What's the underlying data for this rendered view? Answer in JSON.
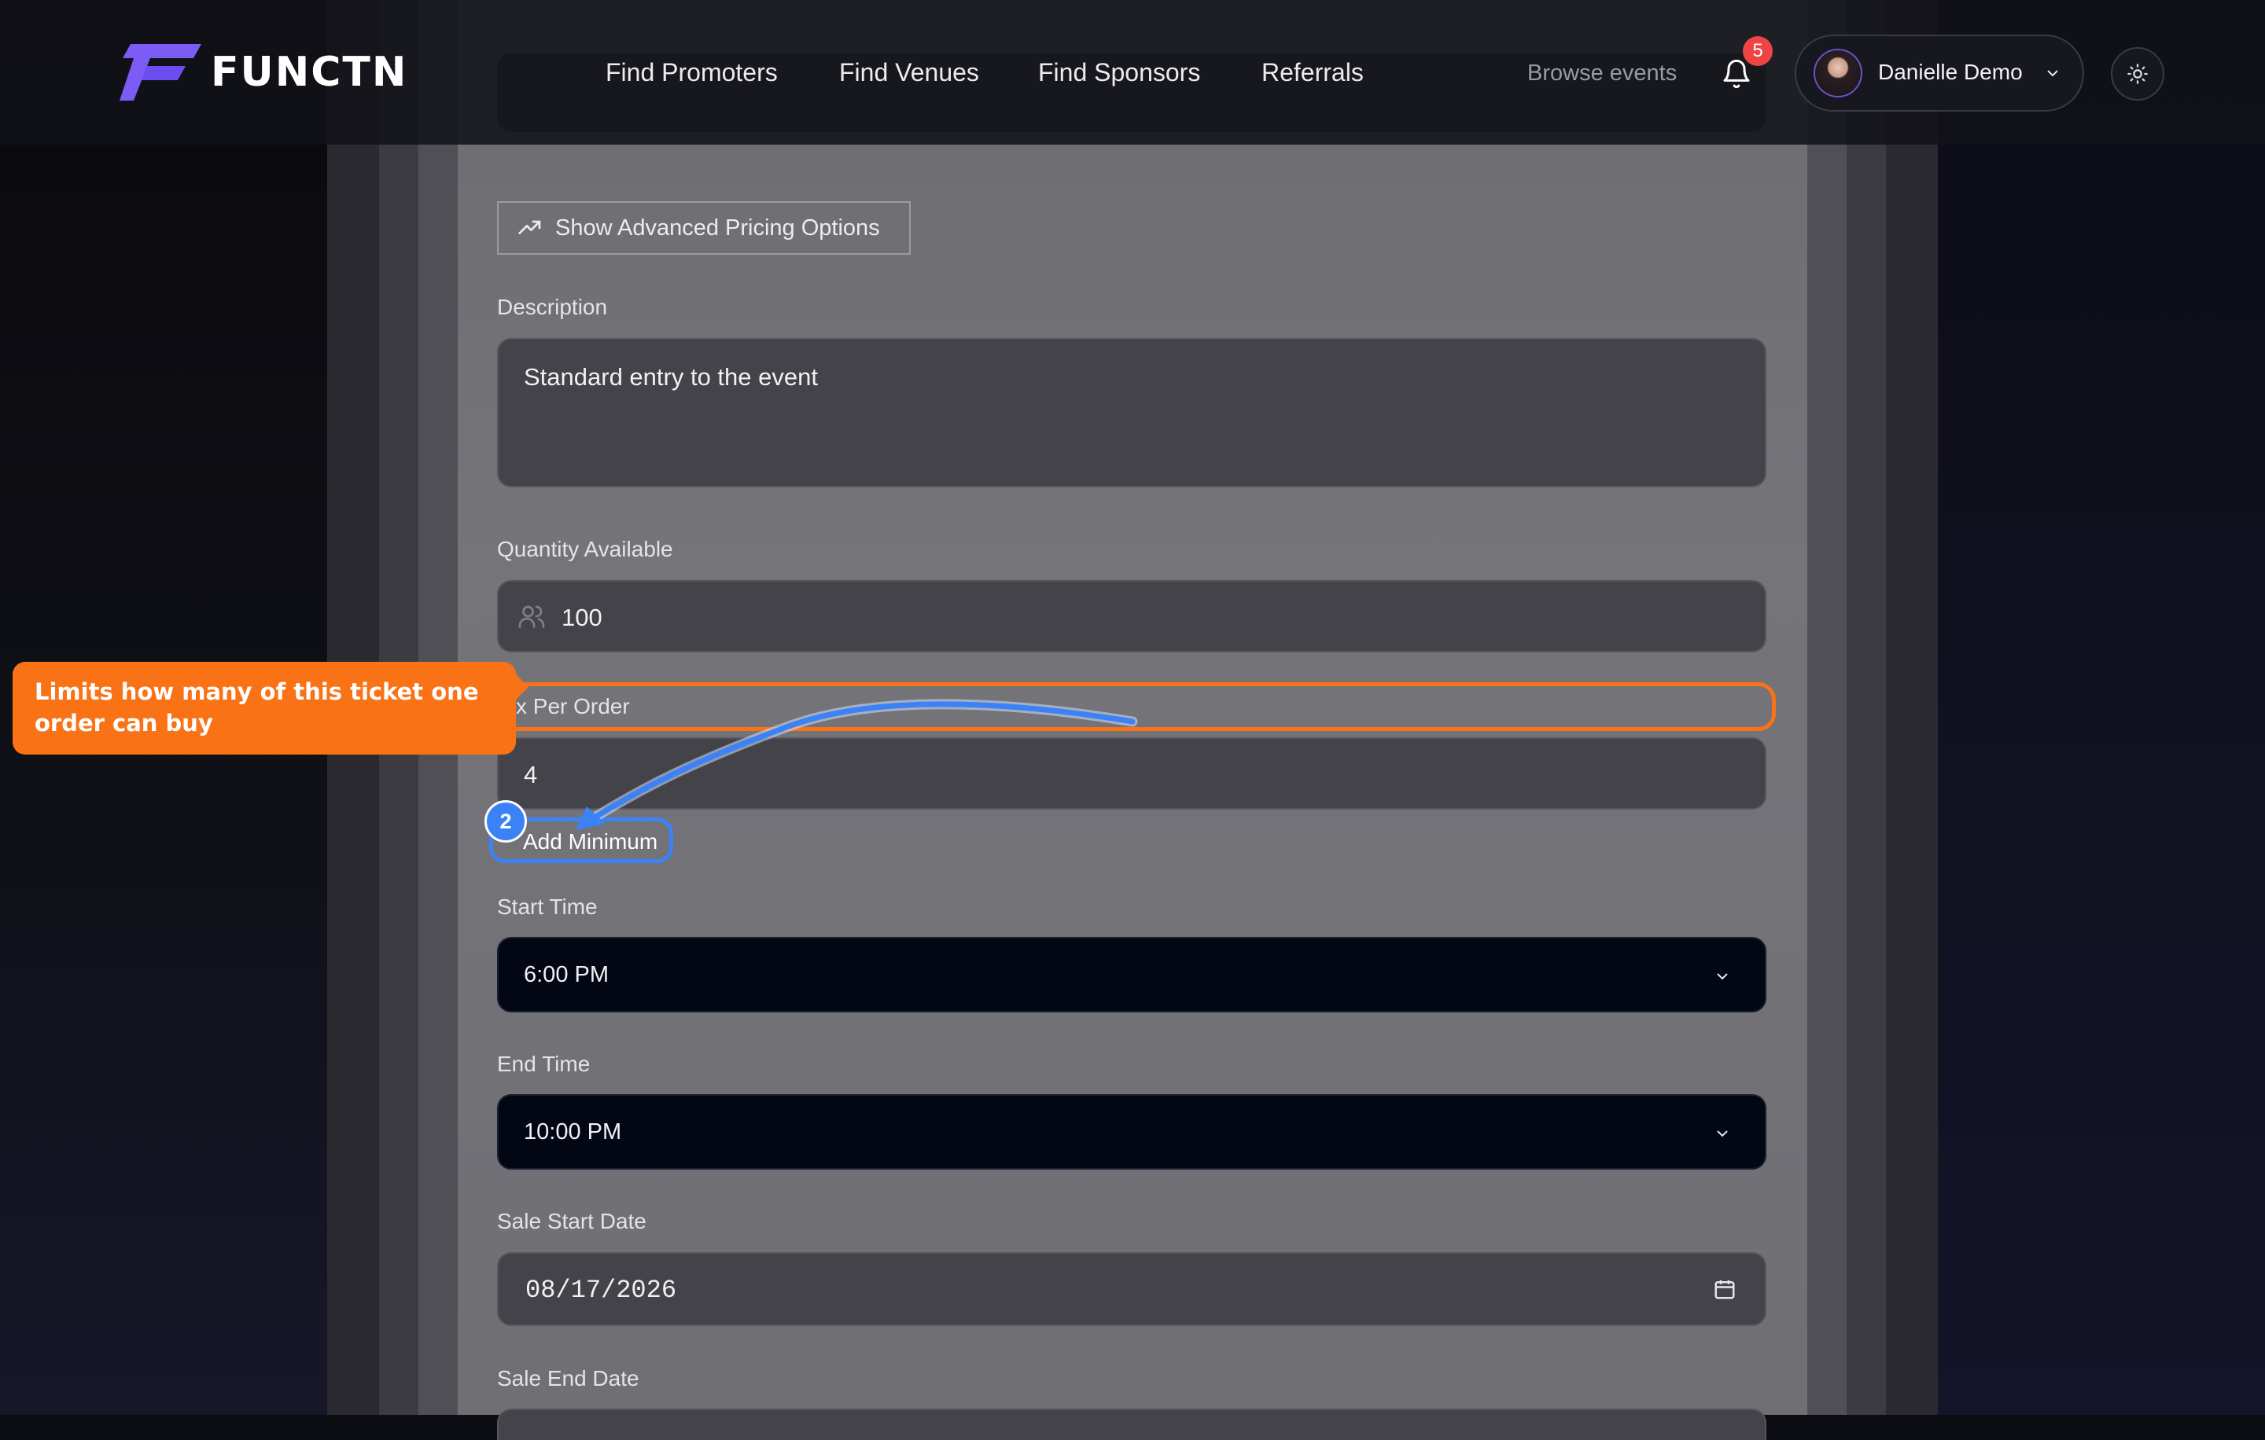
{
  "brand": {
    "name": "FUNCTN"
  },
  "nav": {
    "links": [
      "Find Promoters",
      "Find Venues",
      "Find Sponsors",
      "Referrals"
    ],
    "browse_events": "Browse events",
    "notification_count": "5",
    "user_name": "Danielle Demo"
  },
  "form": {
    "advanced_pricing_label": "Show Advanced Pricing Options",
    "description_label": "Description",
    "description_value": "Standard entry to the event",
    "quantity_label": "Quantity Available",
    "quantity_value": "100",
    "max_per_order_label": "Max Per Order",
    "max_per_order_visible": "x Per Order",
    "max_per_order_value": "4",
    "add_minimum_label": "Add Minimum",
    "start_time_label": "Start Time",
    "start_time_value": "6:00 PM",
    "end_time_label": "End Time",
    "end_time_value": "10:00 PM",
    "sale_start_label": "Sale Start Date",
    "sale_start_value": "08/17/2026",
    "sale_end_label": "Sale End Date"
  },
  "tutorial": {
    "tooltip_text": "Limits how many of this ticket one order can buy",
    "step_number": "2",
    "highlight_color": "#f97316",
    "target_color": "#3b82f6"
  },
  "colors": {
    "brand_purple": "#7c5cf5",
    "badge_red": "#ef4444",
    "navy_select": "#030713"
  }
}
